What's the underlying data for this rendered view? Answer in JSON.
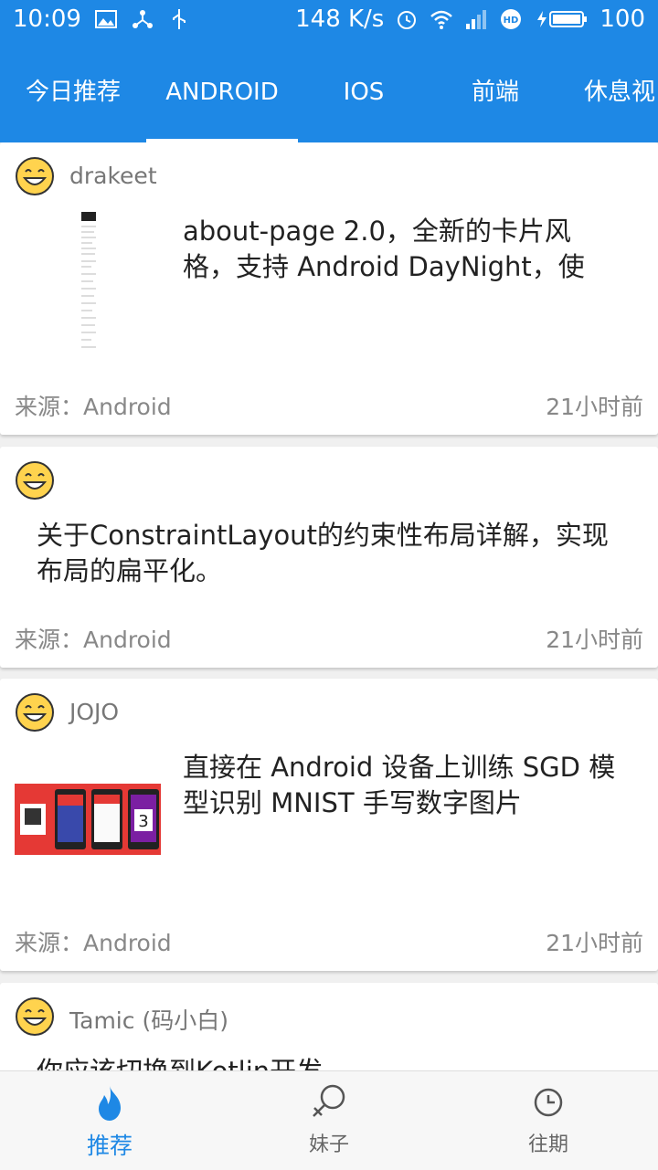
{
  "statusbar": {
    "time": "10:09",
    "speed": "148 K/s",
    "battery": "100"
  },
  "tabs": [
    {
      "label": "今日推荐"
    },
    {
      "label": "ANDROID"
    },
    {
      "label": "IOS"
    },
    {
      "label": "前端"
    },
    {
      "label": "休息视"
    }
  ],
  "cards": [
    {
      "author": "drakeet",
      "title": "about-page 2.0，全新的卡片风格，支持 Android DayNight，使",
      "source": "来源：Android",
      "time": "21小时前"
    },
    {
      "author": "",
      "title": "关于ConstraintLayout的约束性布局详解，实现布局的扁平化。",
      "source": "来源：Android",
      "time": "21小时前"
    },
    {
      "author": "JOJO",
      "title": "直接在 Android 设备上训练 SGD 模型识别 MNIST 手写数字图片",
      "source": "来源：Android",
      "time": "21小时前"
    },
    {
      "author": "Tamic (码小白)",
      "title": "你应该切换到Kotlin开发"
    }
  ],
  "bottom_nav": [
    {
      "label": "推荐"
    },
    {
      "label": "妹子"
    },
    {
      "label": "往期"
    }
  ],
  "colors": {
    "primary": "#1e88e5"
  }
}
